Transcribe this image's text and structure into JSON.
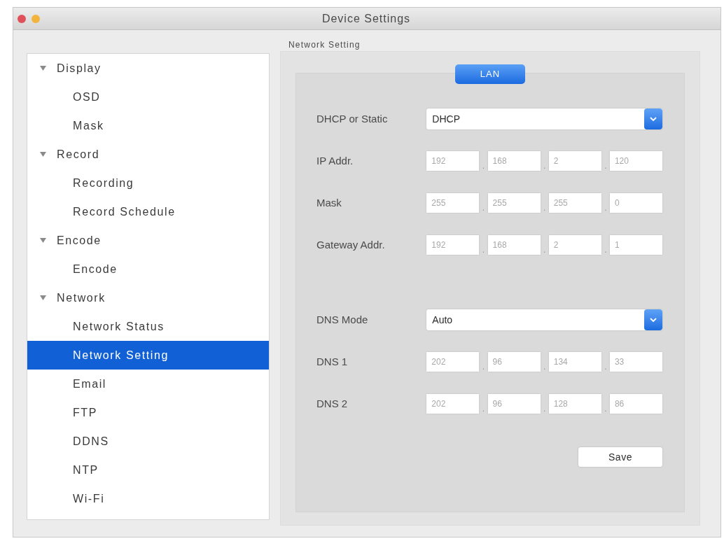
{
  "window": {
    "title": "Device Settings"
  },
  "sidebar": {
    "items": [
      {
        "label": "Display",
        "expanded": true,
        "selected": false,
        "children": [
          {
            "label": "OSD",
            "selected": false
          },
          {
            "label": "Mask",
            "selected": false
          }
        ]
      },
      {
        "label": "Record",
        "expanded": true,
        "selected": false,
        "children": [
          {
            "label": "Recording",
            "selected": false
          },
          {
            "label": "Record Schedule",
            "selected": false
          }
        ]
      },
      {
        "label": "Encode",
        "expanded": true,
        "selected": false,
        "children": [
          {
            "label": "Encode",
            "selected": false
          }
        ]
      },
      {
        "label": "Network",
        "expanded": true,
        "selected": false,
        "children": [
          {
            "label": "Network Status",
            "selected": false
          },
          {
            "label": "Network Setting",
            "selected": true
          },
          {
            "label": "Email",
            "selected": false
          },
          {
            "label": "FTP",
            "selected": false
          },
          {
            "label": "DDNS",
            "selected": false
          },
          {
            "label": "NTP",
            "selected": false
          },
          {
            "label": "Wi-Fi",
            "selected": false
          }
        ]
      }
    ]
  },
  "content": {
    "title": "Network Setting",
    "tabs": [
      {
        "label": "LAN",
        "selected": true
      }
    ],
    "sections": [
      {
        "rows": [
          {
            "kind": "select",
            "label": "DHCP or Static",
            "value": "DHCP"
          },
          {
            "kind": "ip",
            "label": "IP Addr.",
            "disabled": true,
            "separator": ".",
            "octets": [
              "192",
              "168",
              "2",
              "120"
            ]
          },
          {
            "kind": "ip",
            "label": "Mask",
            "disabled": true,
            "separator": ".",
            "octets": [
              "255",
              "255",
              "255",
              "0"
            ]
          },
          {
            "kind": "ip",
            "label": "Gateway Addr.",
            "disabled": true,
            "separator": ".",
            "octets": [
              "192",
              "168",
              "2",
              "1"
            ]
          }
        ]
      },
      {
        "rows": [
          {
            "kind": "select",
            "label": "DNS Mode",
            "value": "Auto"
          },
          {
            "kind": "ip",
            "label": "DNS 1",
            "disabled": true,
            "separator": ".",
            "octets": [
              "202",
              "96",
              "134",
              "33"
            ]
          },
          {
            "kind": "ip",
            "label": "DNS 2",
            "disabled": true,
            "separator": ".",
            "octets": [
              "202",
              "96",
              "128",
              "86"
            ]
          }
        ]
      }
    ],
    "save_button": "Save"
  }
}
